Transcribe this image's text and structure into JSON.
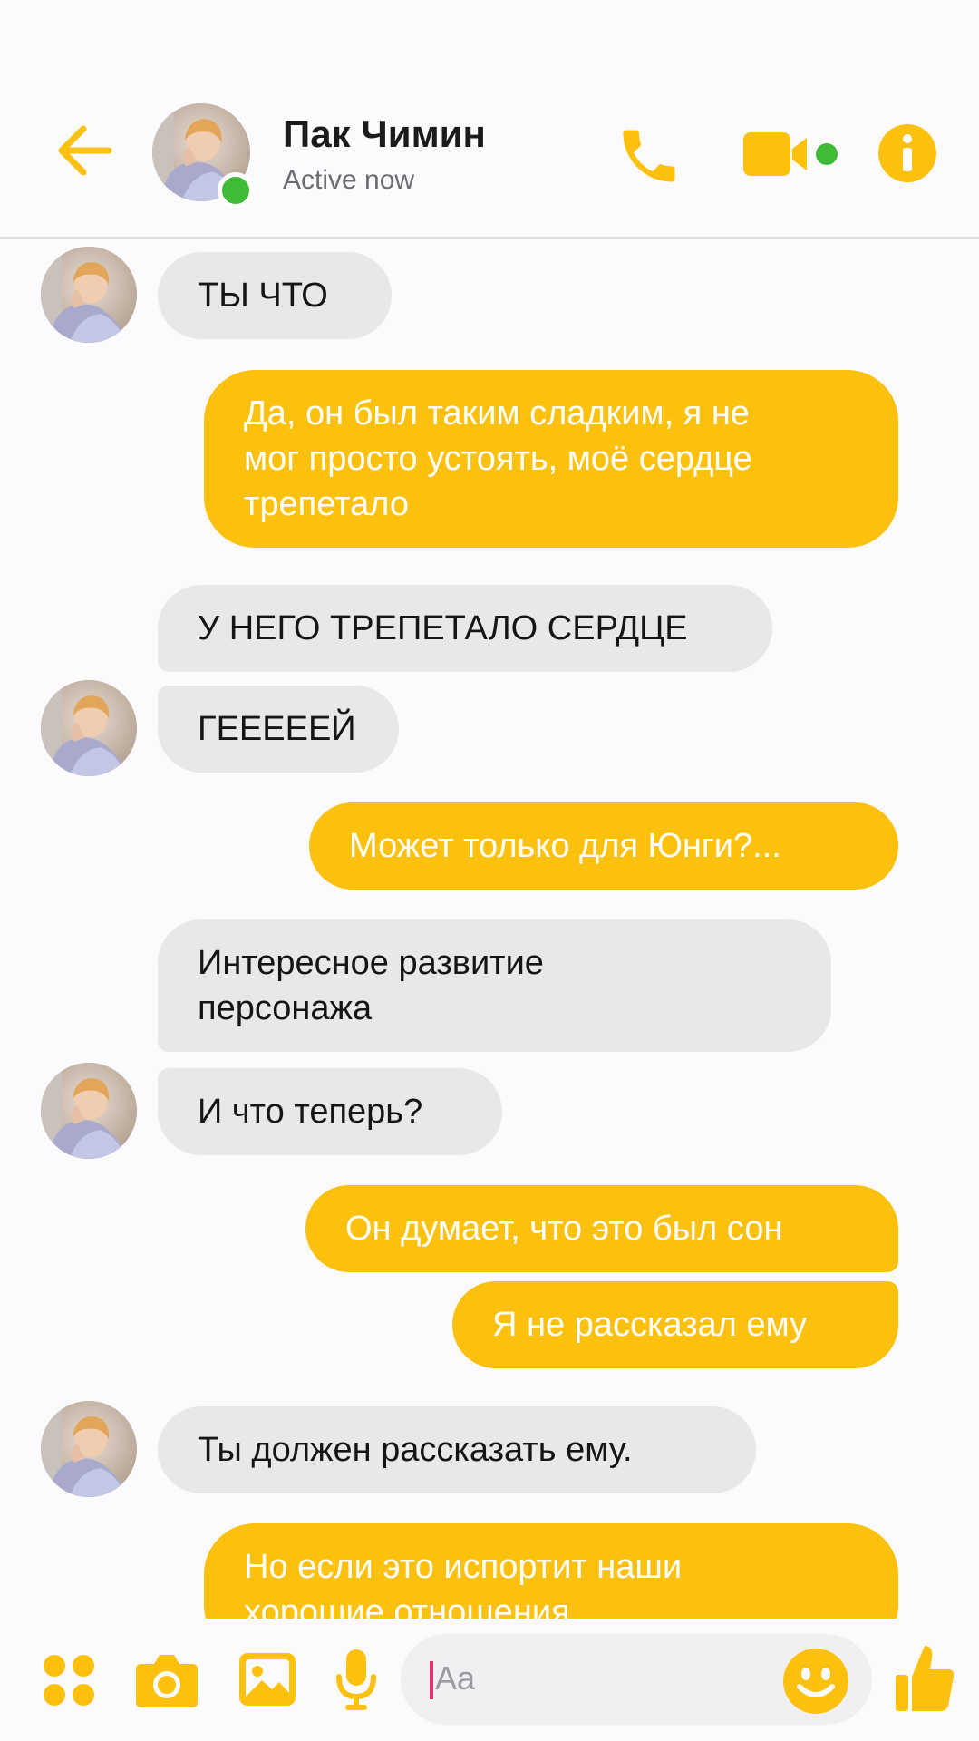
{
  "colors": {
    "accent": "#fcc00e",
    "incoming_bubble": "#e8e8ea",
    "online": "#3fbb37",
    "background": "#fbfbfd"
  },
  "header": {
    "back_icon": "arrow-left-icon",
    "contact_name": "Пак Чимин",
    "status": "Active now",
    "actions": [
      "phone-icon",
      "video-camera-icon",
      "info-icon"
    ]
  },
  "messages": [
    {
      "from": "contact",
      "text": "ТЫ ЧТО"
    },
    {
      "from": "me",
      "text": "Да, он был таким сладким, я не\nмог просто устоять, моё сердце\nтрепетало"
    },
    {
      "from": "contact",
      "text": "У НЕГО ТРЕПЕТАЛО СЕРДЦЕ"
    },
    {
      "from": "contact",
      "text": "ГЕЕЕЕЕЙ"
    },
    {
      "from": "me",
      "text": "Может только для Юнги?..."
    },
    {
      "from": "contact",
      "text": "Интересное развитие\nперсонажа"
    },
    {
      "from": "contact",
      "text": "И что теперь?"
    },
    {
      "from": "me",
      "text": "Он думает, что это был сон"
    },
    {
      "from": "me",
      "text": "Я не рассказал ему"
    },
    {
      "from": "contact",
      "text": "Ты должен рассказать ему."
    },
    {
      "from": "me",
      "text": "Но если это испортит наши\nхорошие отношения"
    }
  ],
  "composer": {
    "placeholder": "Aa",
    "icons": [
      "apps-icon",
      "camera-icon",
      "gallery-icon",
      "microphone-icon",
      "emoji-icon",
      "thumbs-up-icon"
    ]
  }
}
